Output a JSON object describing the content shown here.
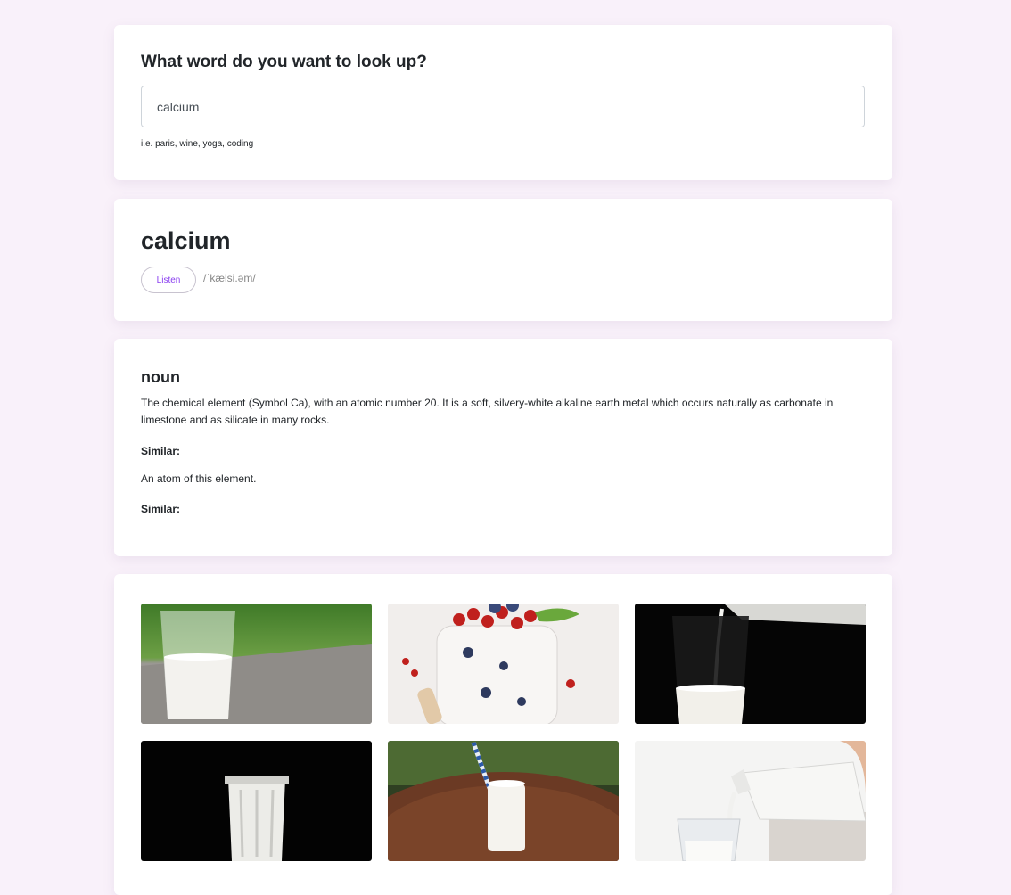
{
  "search": {
    "title": "What word do you want to look up?",
    "value": "calcium",
    "hint": "i.e. paris, wine, yoga, coding"
  },
  "word": {
    "text": "calcium",
    "listen_label": "Listen",
    "phonetic": "/ˈkælsi.əm/"
  },
  "meaning": {
    "part_of_speech": "noun",
    "definitions": [
      {
        "text": "The chemical element (Symbol Ca), with an atomic number 20. It is a soft, silvery-white alkaline earth metal which occurs naturally as carbonate in limestone and as silicate in many rocks.",
        "similar_label": "Similar:"
      },
      {
        "text": "An atom of this element.",
        "similar_label": "Similar:"
      }
    ]
  },
  "images": [
    {
      "name": "milk-glass-on-ledge-image"
    },
    {
      "name": "yogurt-with-berries-image"
    },
    {
      "name": "milk-pouring-dark-image"
    },
    {
      "name": "milk-glass-black-background-image"
    },
    {
      "name": "milk-glass-with-straw-image"
    },
    {
      "name": "milk-bottle-pouring-image"
    }
  ],
  "colors": {
    "page_background": "#f9f1fa",
    "card_background": "#ffffff",
    "accent": "#8a3ff0",
    "text": "#212529",
    "muted": "#888888"
  }
}
